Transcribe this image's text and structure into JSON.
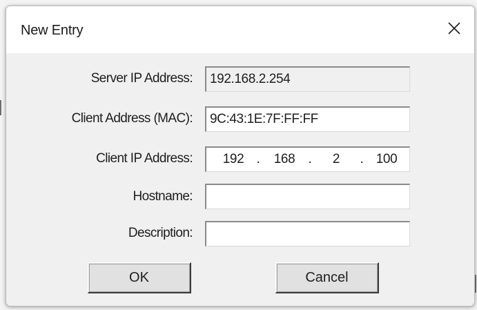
{
  "window": {
    "title": "New Entry",
    "close_icon": "close-icon"
  },
  "form": {
    "server_ip": {
      "label": "Server IP Address:",
      "value": "192.168.2.254"
    },
    "client_mac": {
      "label": "Client Address (MAC):",
      "value": "9C:43:1E:7F:FF:FF"
    },
    "client_ip": {
      "label": "Client IP Address:",
      "octets": [
        "192",
        "168",
        "2",
        "100"
      ],
      "separator": "."
    },
    "hostname": {
      "label": "Hostname:",
      "value": ""
    },
    "description": {
      "label": "Description:",
      "value": ""
    }
  },
  "buttons": {
    "ok": "OK",
    "cancel": "Cancel"
  },
  "colors": {
    "dialog_bg": "#f0f0f0",
    "titlebar_bg": "#ffffff",
    "field_bg": "#ffffff",
    "readonly_field_bg": "#f0f0f0"
  }
}
